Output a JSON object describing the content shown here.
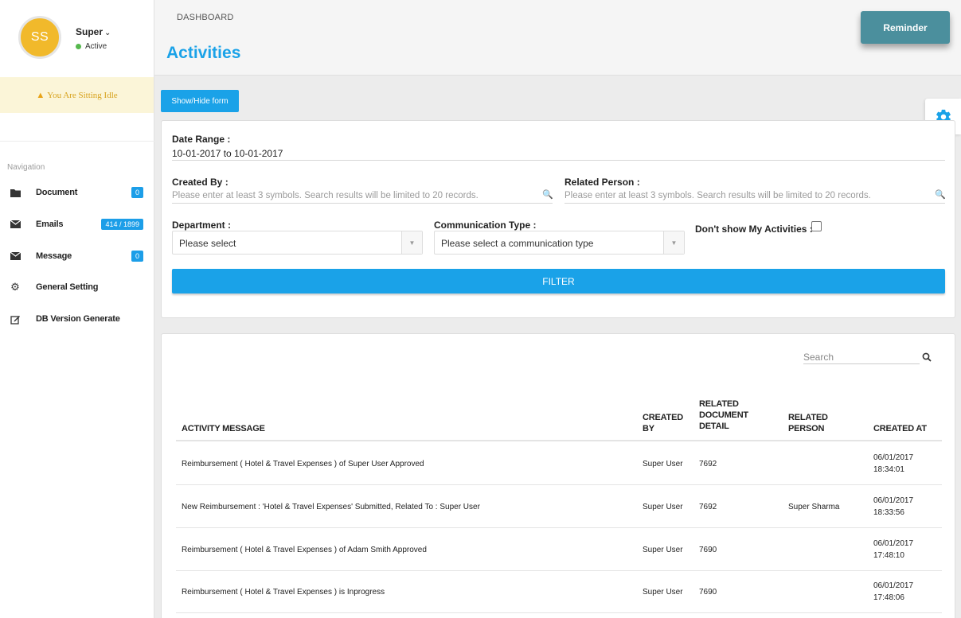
{
  "user": {
    "initials": "SS",
    "name": "Super",
    "name_caret": "⌄",
    "status": "Active"
  },
  "idle_banner": {
    "icon": "warning-icon",
    "text": "You Are Sitting Idle"
  },
  "nav": {
    "heading": "Navigation",
    "items": [
      {
        "label": "Document",
        "icon": "folder-icon",
        "badge": "0"
      },
      {
        "label": "Emails",
        "icon": "envelope-icon",
        "badge": "414 / 1899"
      },
      {
        "label": "Message",
        "icon": "envelope-icon",
        "badge": "0"
      },
      {
        "label": "General Setting",
        "icon": "gear-icon",
        "badge": ""
      },
      {
        "label": "DB Version Generate",
        "icon": "edit-icon",
        "badge": ""
      }
    ]
  },
  "header": {
    "breadcrumb": "DASHBOARD",
    "title": "Activities",
    "reminder_label": "Reminder"
  },
  "toggle_form_label": "Show/Hide form",
  "form": {
    "date_range_label": "Date Range :",
    "date_range_value": "10-01-2017 to 10-01-2017",
    "created_by_label": "Created By :",
    "created_by_placeholder": "Please enter at least 3 symbols. Search results will be limited to 20 records.",
    "related_person_label": "Related Person :",
    "related_person_placeholder": "Please enter at least 3 symbols. Search results will be limited to 20 records.",
    "department_label": "Department :",
    "department_value": "Please select",
    "comm_type_label": "Communication Type :",
    "comm_type_value": "Please select a communication type",
    "dont_show_label": "Don't show My Activities :",
    "filter_label": "FILTER"
  },
  "table": {
    "search_placeholder": "Search",
    "headers": {
      "activity": "ACTIVITY MESSAGE",
      "created_by_1": "CREATED",
      "created_by_2": "BY",
      "rdd_1": "RELATED",
      "rdd_2": "DOCUMENT",
      "rdd_3": "DETAIL",
      "rp_1": "RELATED",
      "rp_2": "PERSON",
      "created_at": "CREATED AT"
    },
    "rows": [
      {
        "message": "Reimbursement ( Hotel & Travel Expenses ) of Super User Approved",
        "created_by": "Super User",
        "doc": "7692",
        "person": "",
        "date": "06/01/2017",
        "time": "18:34:01"
      },
      {
        "message": "New Reimbursement : 'Hotel & Travel Expenses' Submitted, Related To : Super User",
        "created_by": "Super User",
        "doc": "7692",
        "person": "Super Sharma",
        "date": "06/01/2017",
        "time": "18:33:56"
      },
      {
        "message": "Reimbursement ( Hotel & Travel Expenses ) of Adam Smith Approved",
        "created_by": "Super User",
        "doc": "7690",
        "person": "",
        "date": "06/01/2017",
        "time": "17:48:10"
      },
      {
        "message": "Reimbursement ( Hotel & Travel Expenses ) is Inprogress",
        "created_by": "Super User",
        "doc": "7690",
        "person": "",
        "date": "06/01/2017",
        "time": "17:48:06"
      }
    ]
  },
  "colors": {
    "accent": "#1aa2e8",
    "reminder": "#4b8f9d",
    "avatar": "#f1b92b",
    "active_dot": "#56b84e",
    "idle_bg": "#fbf5d8",
    "idle_text": "#d7a21c"
  }
}
